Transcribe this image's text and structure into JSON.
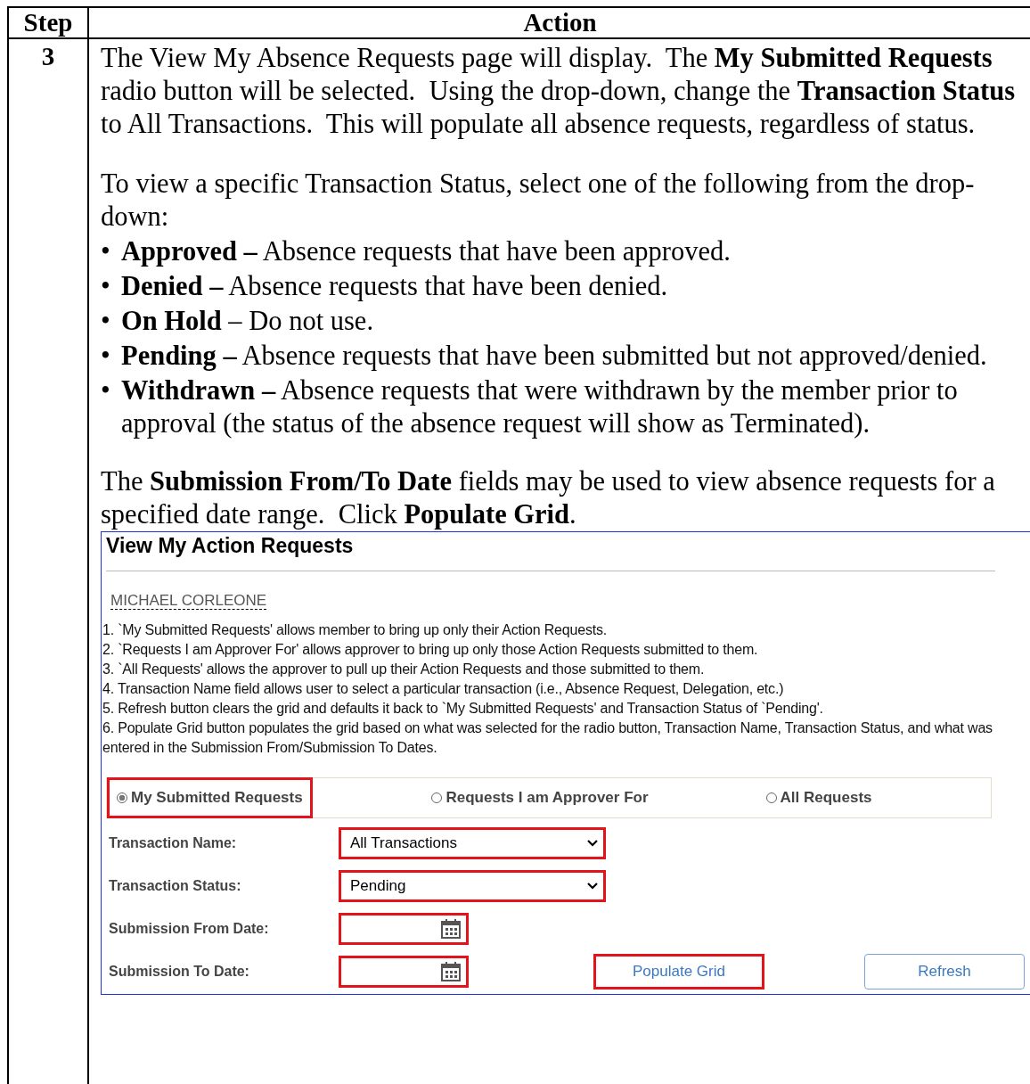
{
  "table": {
    "columns": [
      "Step",
      "Action"
    ],
    "row": {
      "step": "3",
      "intro": "The View My Absence Requests page will display.  The **My Submitted Requests** radio button will be selected.  Using the drop-down, change the **Transaction Status** to All Transactions.  This will populate all absence requests, regardless of status.",
      "lead": "To view a specific Transaction Status, select one of the following from the drop-down:",
      "bullets": [
        {
          "marker": "•",
          "text": "**Approved –** Absence requests that have been approved."
        },
        {
          "marker": "•",
          "text": "**Denied –** Absence requests that have been denied."
        },
        {
          "marker": "•",
          "text": "**On Hold** – Do not use."
        },
        {
          "marker": "•",
          "text": "**Pending –** Absence requests that have been submitted but not approved/denied."
        },
        {
          "marker": "•",
          "text": "**Withdrawn –** Absence requests that were withdrawn by the member prior to approval (the status of the absence request will show as Terminated)."
        }
      ],
      "closing": "The **Submission From/To Date** fields may be used to view absence requests for a specified date range.  Click **Populate Grid**.",
      "screenshot": {
        "title": "View My Action Requests",
        "user": "MICHAEL CORLEONE",
        "notes": [
          "1. `My Submitted Requests' allows member to bring up only their Action Requests.",
          "2. `Requests I am Approver For' allows approver to bring up only those Action Requests submitted to them.",
          "3. `All Requests' allows the approver to pull up their Action Requests and those submitted to them.",
          "4. Transaction Name field allows user to select a particular transaction (i.e., Absence Request, Delegation, etc.)",
          "5. Refresh button clears the grid and defaults it back to `My Submitted Requests' and Transaction Status of `Pending'.",
          "6. Populate Grid button populates the grid based on what was selected for the radio button, Transaction Name, Transaction Status, and what was entered in the Submission From/Submission To Dates."
        ],
        "radios": [
          {
            "label": "My Submitted Requests",
            "selected": true,
            "highlighted": true
          },
          {
            "label": "Requests I am Approver For",
            "selected": false,
            "highlighted": false
          },
          {
            "label": "All Requests",
            "selected": false,
            "highlighted": false
          }
        ],
        "fields": [
          {
            "kind": "select",
            "label": "Transaction Name:",
            "value": "All Transactions",
            "highlighted": true
          },
          {
            "kind": "select",
            "label": "Transaction Status:",
            "value": "Pending",
            "highlighted": true
          },
          {
            "kind": "date",
            "label": "Submission From Date:",
            "highlighted": true
          },
          {
            "kind": "date",
            "label": "Submission To Date:",
            "highlighted": true
          }
        ],
        "buttons": [
          {
            "label": "Populate Grid",
            "highlighted": true
          },
          {
            "label": "Refresh",
            "highlighted": false
          }
        ]
      }
    }
  }
}
